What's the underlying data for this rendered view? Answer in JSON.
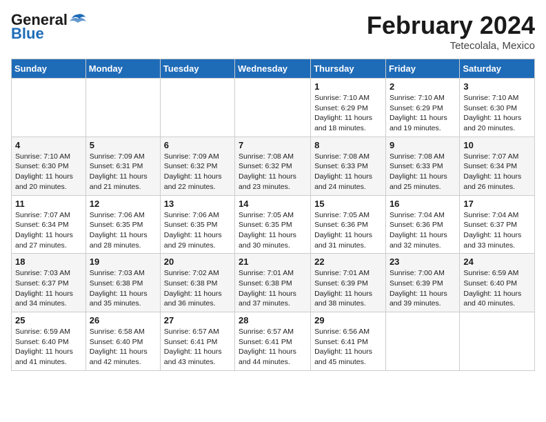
{
  "header": {
    "logo_general": "General",
    "logo_blue": "Blue",
    "month": "February 2024",
    "location": "Tetecolala, Mexico"
  },
  "days_of_week": [
    "Sunday",
    "Monday",
    "Tuesday",
    "Wednesday",
    "Thursday",
    "Friday",
    "Saturday"
  ],
  "weeks": [
    [
      {
        "day": "",
        "info": ""
      },
      {
        "day": "",
        "info": ""
      },
      {
        "day": "",
        "info": ""
      },
      {
        "day": "",
        "info": ""
      },
      {
        "day": "1",
        "info": "Sunrise: 7:10 AM\nSunset: 6:29 PM\nDaylight: 11 hours\nand 18 minutes."
      },
      {
        "day": "2",
        "info": "Sunrise: 7:10 AM\nSunset: 6:29 PM\nDaylight: 11 hours\nand 19 minutes."
      },
      {
        "day": "3",
        "info": "Sunrise: 7:10 AM\nSunset: 6:30 PM\nDaylight: 11 hours\nand 20 minutes."
      }
    ],
    [
      {
        "day": "4",
        "info": "Sunrise: 7:10 AM\nSunset: 6:30 PM\nDaylight: 11 hours\nand 20 minutes."
      },
      {
        "day": "5",
        "info": "Sunrise: 7:09 AM\nSunset: 6:31 PM\nDaylight: 11 hours\nand 21 minutes."
      },
      {
        "day": "6",
        "info": "Sunrise: 7:09 AM\nSunset: 6:32 PM\nDaylight: 11 hours\nand 22 minutes."
      },
      {
        "day": "7",
        "info": "Sunrise: 7:08 AM\nSunset: 6:32 PM\nDaylight: 11 hours\nand 23 minutes."
      },
      {
        "day": "8",
        "info": "Sunrise: 7:08 AM\nSunset: 6:33 PM\nDaylight: 11 hours\nand 24 minutes."
      },
      {
        "day": "9",
        "info": "Sunrise: 7:08 AM\nSunset: 6:33 PM\nDaylight: 11 hours\nand 25 minutes."
      },
      {
        "day": "10",
        "info": "Sunrise: 7:07 AM\nSunset: 6:34 PM\nDaylight: 11 hours\nand 26 minutes."
      }
    ],
    [
      {
        "day": "11",
        "info": "Sunrise: 7:07 AM\nSunset: 6:34 PM\nDaylight: 11 hours\nand 27 minutes."
      },
      {
        "day": "12",
        "info": "Sunrise: 7:06 AM\nSunset: 6:35 PM\nDaylight: 11 hours\nand 28 minutes."
      },
      {
        "day": "13",
        "info": "Sunrise: 7:06 AM\nSunset: 6:35 PM\nDaylight: 11 hours\nand 29 minutes."
      },
      {
        "day": "14",
        "info": "Sunrise: 7:05 AM\nSunset: 6:35 PM\nDaylight: 11 hours\nand 30 minutes."
      },
      {
        "day": "15",
        "info": "Sunrise: 7:05 AM\nSunset: 6:36 PM\nDaylight: 11 hours\nand 31 minutes."
      },
      {
        "day": "16",
        "info": "Sunrise: 7:04 AM\nSunset: 6:36 PM\nDaylight: 11 hours\nand 32 minutes."
      },
      {
        "day": "17",
        "info": "Sunrise: 7:04 AM\nSunset: 6:37 PM\nDaylight: 11 hours\nand 33 minutes."
      }
    ],
    [
      {
        "day": "18",
        "info": "Sunrise: 7:03 AM\nSunset: 6:37 PM\nDaylight: 11 hours\nand 34 minutes."
      },
      {
        "day": "19",
        "info": "Sunrise: 7:03 AM\nSunset: 6:38 PM\nDaylight: 11 hours\nand 35 minutes."
      },
      {
        "day": "20",
        "info": "Sunrise: 7:02 AM\nSunset: 6:38 PM\nDaylight: 11 hours\nand 36 minutes."
      },
      {
        "day": "21",
        "info": "Sunrise: 7:01 AM\nSunset: 6:38 PM\nDaylight: 11 hours\nand 37 minutes."
      },
      {
        "day": "22",
        "info": "Sunrise: 7:01 AM\nSunset: 6:39 PM\nDaylight: 11 hours\nand 38 minutes."
      },
      {
        "day": "23",
        "info": "Sunrise: 7:00 AM\nSunset: 6:39 PM\nDaylight: 11 hours\nand 39 minutes."
      },
      {
        "day": "24",
        "info": "Sunrise: 6:59 AM\nSunset: 6:40 PM\nDaylight: 11 hours\nand 40 minutes."
      }
    ],
    [
      {
        "day": "25",
        "info": "Sunrise: 6:59 AM\nSunset: 6:40 PM\nDaylight: 11 hours\nand 41 minutes."
      },
      {
        "day": "26",
        "info": "Sunrise: 6:58 AM\nSunset: 6:40 PM\nDaylight: 11 hours\nand 42 minutes."
      },
      {
        "day": "27",
        "info": "Sunrise: 6:57 AM\nSunset: 6:41 PM\nDaylight: 11 hours\nand 43 minutes."
      },
      {
        "day": "28",
        "info": "Sunrise: 6:57 AM\nSunset: 6:41 PM\nDaylight: 11 hours\nand 44 minutes."
      },
      {
        "day": "29",
        "info": "Sunrise: 6:56 AM\nSunset: 6:41 PM\nDaylight: 11 hours\nand 45 minutes."
      },
      {
        "day": "",
        "info": ""
      },
      {
        "day": "",
        "info": ""
      }
    ]
  ]
}
